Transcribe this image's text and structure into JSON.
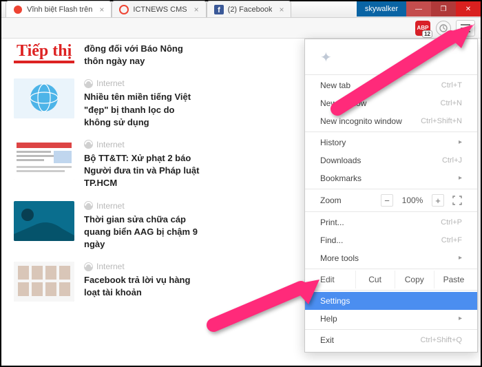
{
  "window": {
    "user": "skywalker"
  },
  "tabs": [
    {
      "label": "Vĩnh biệt Flash trên",
      "favicon": "red-circle"
    },
    {
      "label": "ICTNEWS CMS",
      "favicon": "red-circle"
    },
    {
      "label": "(2) Facebook",
      "favicon": "facebook"
    }
  ],
  "toolbar": {
    "abp_label": "ABP",
    "abp_badge": "12"
  },
  "page": {
    "logo": "Tiếp thị",
    "articles": [
      {
        "category": "",
        "title": "đồng đối với Báo Nông thôn ngày nay",
        "thumb": "none"
      },
      {
        "category": "Internet",
        "title": "Nhiều tên miền tiếng Việt \"đẹp\" bị thanh lọc do không sử dụng",
        "thumb": "globe"
      },
      {
        "category": "Internet",
        "title": "Bộ TT&TT: Xử phạt 2 báo Người đưa tin và Pháp luật TP.HCM",
        "thumb": "news"
      },
      {
        "category": "Internet",
        "title": "Thời gian sửa chữa cáp quang biển AAG bị chậm 9 ngày",
        "thumb": "ocean"
      },
      {
        "category": "Internet",
        "title": "Facebook trả lời vụ hàng loạt tài khoản",
        "thumb": "grid"
      }
    ]
  },
  "menu": {
    "new_tab": "New tab",
    "new_tab_sc": "Ctrl+T",
    "new_window": "New window",
    "new_window_sc": "Ctrl+N",
    "new_incognito": "New incognito window",
    "new_incognito_sc": "Ctrl+Shift+N",
    "history": "History",
    "downloads": "Downloads",
    "downloads_sc": "Ctrl+J",
    "bookmarks": "Bookmarks",
    "zoom": "Zoom",
    "zoom_val": "100%",
    "print": "Print...",
    "print_sc": "Ctrl+P",
    "find": "Find...",
    "find_sc": "Ctrl+F",
    "more_tools": "More tools",
    "edit": "Edit",
    "cut": "Cut",
    "copy": "Copy",
    "paste": "Paste",
    "settings": "Settings",
    "help": "Help",
    "exit": "Exit",
    "exit_sc": "Ctrl+Shift+Q"
  }
}
